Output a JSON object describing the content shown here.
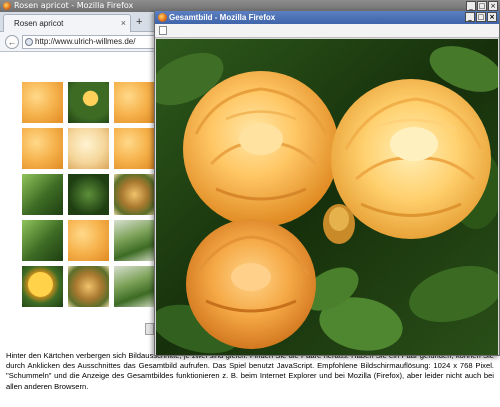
{
  "background_window": {
    "title": "Rosen apricot - Mozilla Firefox",
    "tab_label": "Rosen apricot",
    "tab_close": "×",
    "new_tab": "+",
    "back": "←",
    "url": "http://www.ulrich-willmes.de/",
    "window_buttons": [
      "_",
      "□",
      "×"
    ]
  },
  "tiles": [
    {
      "kind": "rose-orange"
    },
    {
      "kind": "bud-green"
    },
    {
      "kind": "rose-orange"
    },
    {
      "kind": "rose-orange"
    },
    {
      "kind": "rose-pale"
    },
    {
      "kind": "rose-orange"
    },
    {
      "kind": "leaf-green"
    },
    {
      "kind": "leaf-dark"
    },
    {
      "kind": "stamen"
    },
    {
      "kind": "leaf-green"
    },
    {
      "kind": "rose-orange"
    },
    {
      "kind": "leaf-mixed"
    },
    {
      "kind": "bud-yellow"
    },
    {
      "kind": "stamen"
    },
    {
      "kind": "leaf-mixed"
    }
  ],
  "description": "Hinter den Kärtchen verbergen sich Bildausschnitte, je zwei sind gleich. Finden Sie die Paare heraus. Haben Sie ein Paar gefunden, können Sie durch Anklicken des Ausschnittes das Gesamtbild aufrufen. Das Spiel benutzt JavaScript. Empfohlene Bildschirmauflösung: 1024 x 768 Pixel. \"Schummeln\" und die Anzeige des Gesamtbildes funktionieren z. B. beim Internet Explorer und bei Mozilla (Firefox), aber leider nicht auch bei allen anderen Browsern.",
  "popup_window": {
    "title": "Gesamtbild - Mozilla Firefox",
    "url": "",
    "window_buttons": [
      "_",
      "□",
      "×"
    ],
    "image_alt": "Apricot roses"
  },
  "colors": {
    "rose_light": "#ffd98a",
    "rose_mid": "#f6b24c",
    "rose_deep": "#e08a22",
    "leaf_dark": "#1f3f12",
    "leaf_mid": "#3d6b24",
    "popup_titlebar": "#4a6fb3"
  }
}
